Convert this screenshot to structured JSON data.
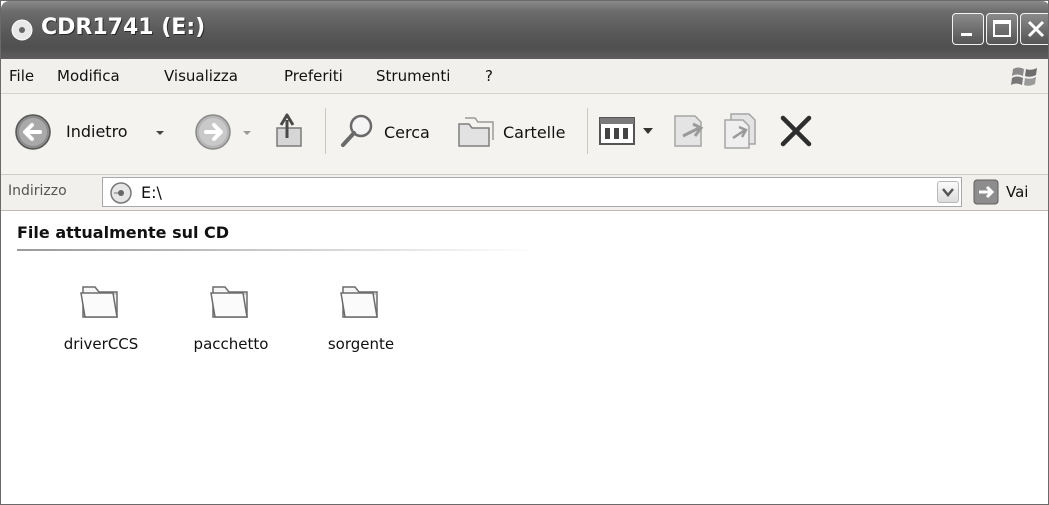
{
  "window": {
    "title": "CDR1741 (E:)",
    "colors": {
      "titlebar": "#5b5b5b",
      "chrome": "#f1f0ec",
      "content": "#ffffff"
    }
  },
  "menu": {
    "items": [
      "File",
      "Modifica",
      "Visualizza",
      "Preferiti",
      "Strumenti",
      "?"
    ]
  },
  "toolbar": {
    "back_label": "Indietro",
    "search_label": "Cerca",
    "folders_label": "Cartelle"
  },
  "address": {
    "label": "Indirizzo",
    "value": "E:\\",
    "go_label": "Vai"
  },
  "content": {
    "group_title": "File attualmente sul CD",
    "folders": [
      {
        "name": "driverCCS",
        "icon": "folder-icon"
      },
      {
        "name": "pacchetto",
        "icon": "folder-icon"
      },
      {
        "name": "sorgente",
        "icon": "folder-icon"
      }
    ]
  }
}
